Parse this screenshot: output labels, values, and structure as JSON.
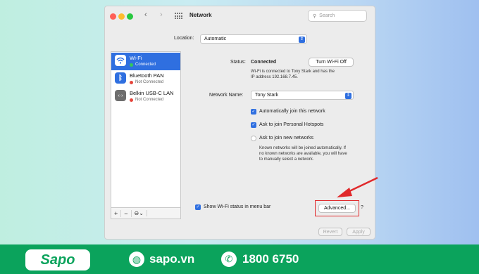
{
  "window": {
    "title": "Network",
    "search_placeholder": "Search",
    "location_label": "Location:",
    "location_value": "Automatic"
  },
  "services": [
    {
      "name": "Wi-Fi",
      "status": "Connected",
      "status_color": "#34c759",
      "icon": "wifi-icon"
    },
    {
      "name": "Bluetooth PAN",
      "status": "Not Connected",
      "status_color": "#e5453b",
      "icon": "bluetooth-icon"
    },
    {
      "name": "Belkin USB-C LAN",
      "status": "Not Connected",
      "status_color": "#e5453b",
      "icon": "ethernet-icon"
    }
  ],
  "detail": {
    "status_label": "Status:",
    "status_value": "Connected",
    "turn_off_label": "Turn Wi-Fi Off",
    "status_desc_1": "Wi-Fi is connected to Tony Stark and has the",
    "status_desc_2": "IP address 192.168.7.45.",
    "network_name_label": "Network Name:",
    "network_name_value": "Tony Stark",
    "option_auto_join": "Automatically join this network",
    "option_hotspots": "Ask to join Personal Hotspots",
    "option_new_networks": "Ask to join new networks",
    "note_1": "Known networks will be joined automatically. If",
    "note_2": "no known networks are available, you will have",
    "note_3": "to manually select a network.",
    "show_status_label": "Show Wi-Fi status in menu bar",
    "advanced_label": "Advanced...",
    "help_label": "?",
    "revert_label": "Revert",
    "apply_label": "Apply"
  },
  "footer": {
    "brand": "Sapo",
    "website": "sapo.vn",
    "phone": "1800 6750"
  },
  "colors": {
    "accent": "#2f6fe0",
    "highlight_box": "#e0292b",
    "brand_green": "#0ba35c"
  }
}
